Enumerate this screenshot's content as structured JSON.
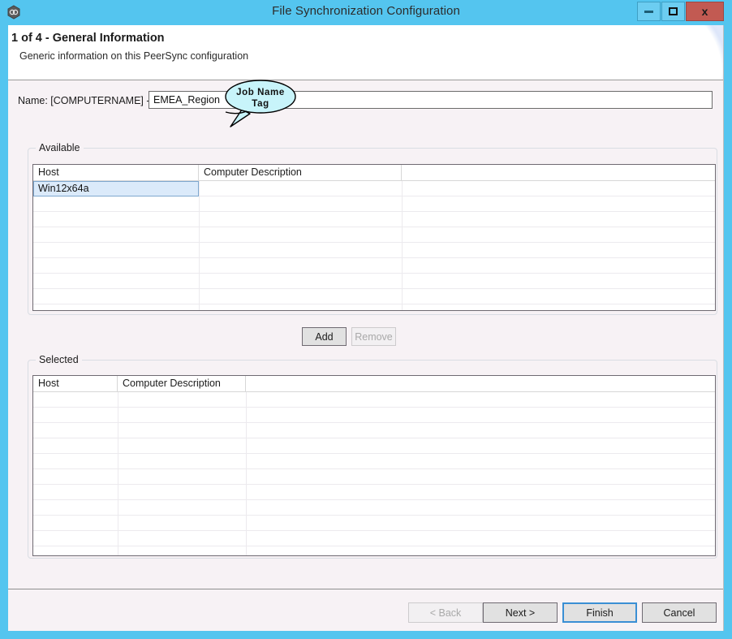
{
  "window": {
    "title": "File Synchronization Configuration",
    "icon": "app-logo-icon",
    "accent_color": "#54c5ef",
    "caption": {
      "minimize_label": "–",
      "maximize_label": "□",
      "close_label": "x"
    }
  },
  "header": {
    "step_title": "1 of 4 - General Information",
    "step_description": "Generic information on this PeerSync configuration"
  },
  "name_row": {
    "label": "Name: [COMPUTERNAME] -",
    "value": "EMEA_Region",
    "placeholder": ""
  },
  "callout": {
    "line1": "Job Name",
    "line2": "Tag",
    "fill_color": "#c8f4fa",
    "stroke_color": "#000000"
  },
  "available": {
    "legend": "Available",
    "columns": [
      "Host",
      "Computer Description",
      ""
    ],
    "rows": [
      {
        "host": "Win12x64a",
        "description": "",
        "selected": true
      },
      {
        "host": "",
        "description": "",
        "selected": false
      },
      {
        "host": "",
        "description": "",
        "selected": false
      },
      {
        "host": "",
        "description": "",
        "selected": false
      },
      {
        "host": "",
        "description": "",
        "selected": false
      },
      {
        "host": "",
        "description": "",
        "selected": false
      },
      {
        "host": "",
        "description": "",
        "selected": false
      },
      {
        "host": "",
        "description": "",
        "selected": false
      },
      {
        "host": "",
        "description": "",
        "selected": false
      }
    ]
  },
  "transfer_buttons": {
    "add_label": "Add",
    "add_enabled": true,
    "remove_label": "Remove",
    "remove_enabled": false
  },
  "selected": {
    "legend": "Selected",
    "columns": [
      "Host",
      "Computer Description",
      ""
    ],
    "rows": [
      {
        "host": "",
        "description": ""
      },
      {
        "host": "",
        "description": ""
      },
      {
        "host": "",
        "description": ""
      },
      {
        "host": "",
        "description": ""
      },
      {
        "host": "",
        "description": ""
      },
      {
        "host": "",
        "description": ""
      },
      {
        "host": "",
        "description": ""
      },
      {
        "host": "",
        "description": ""
      },
      {
        "host": "",
        "description": ""
      },
      {
        "host": "",
        "description": ""
      },
      {
        "host": "",
        "description": ""
      }
    ]
  },
  "footer": {
    "back_label": "< Back",
    "back_enabled": false,
    "next_label": "Next >",
    "next_enabled": true,
    "finish_label": "Finish",
    "finish_focused": true,
    "cancel_label": "Cancel"
  }
}
